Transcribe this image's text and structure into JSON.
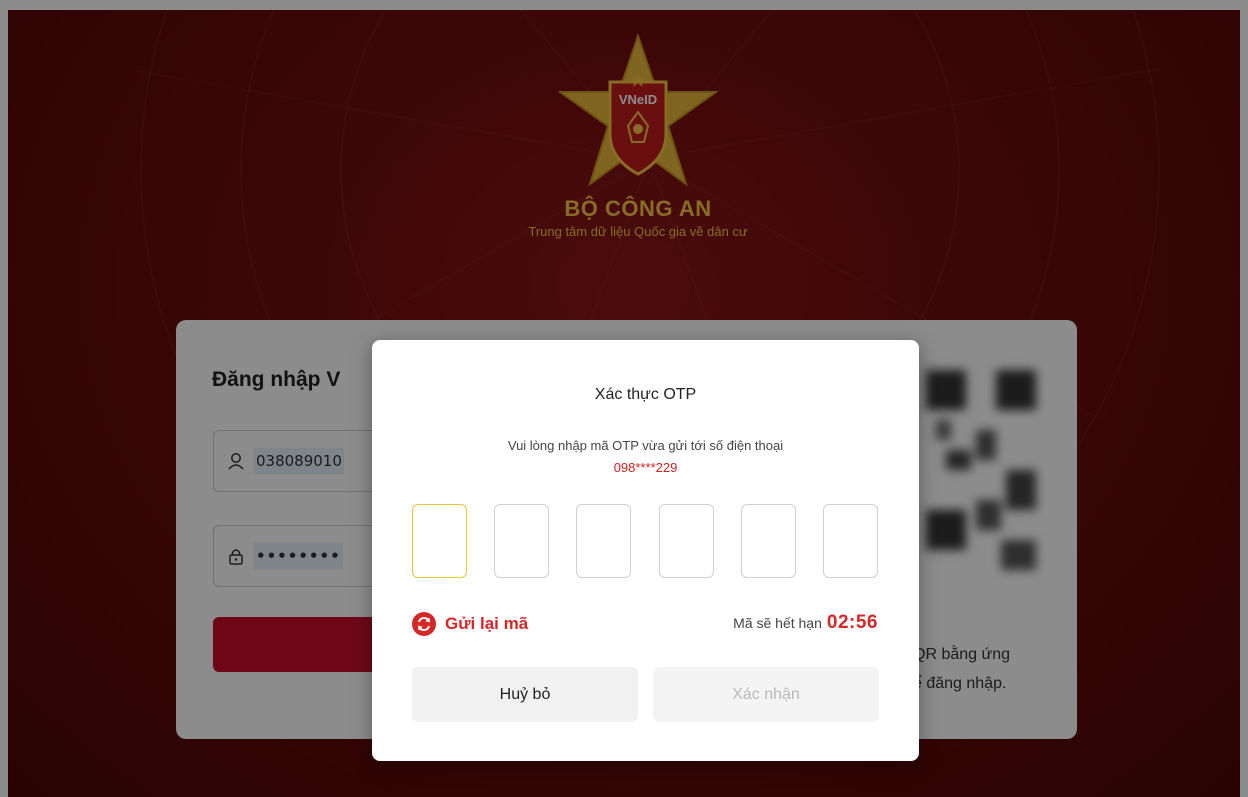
{
  "header": {
    "org_name": "BỘ CÔNG AN",
    "org_subtitle": "Trung tâm dữ liệu Quốc gia về dân cư",
    "logo_text": "VNeID"
  },
  "login": {
    "title": "Đăng nhập V",
    "username_value": "038089010",
    "password_value": "••••••••",
    "qr_text_line1": "QR bằng ứng",
    "qr_text_line2": "ể đăng nhập."
  },
  "otp_modal": {
    "title": "Xác thực OTP",
    "description": "Vui lòng nhập mã OTP vừa gửi tới số điện thoại",
    "phone": "098****229",
    "digits": [
      "",
      "",
      "",
      "",
      "",
      ""
    ],
    "resend_label": "Gửi lại mã",
    "expire_label": "Mã sẽ hết hạn",
    "expire_time": "02:56",
    "cancel_label": "Huỷ bỏ",
    "confirm_label": "Xác nhận"
  },
  "colors": {
    "background": "#6e0d0d",
    "brand_gold": "#f4c542",
    "accent_red": "#d62727",
    "focus_yellow": "#f2c230"
  }
}
